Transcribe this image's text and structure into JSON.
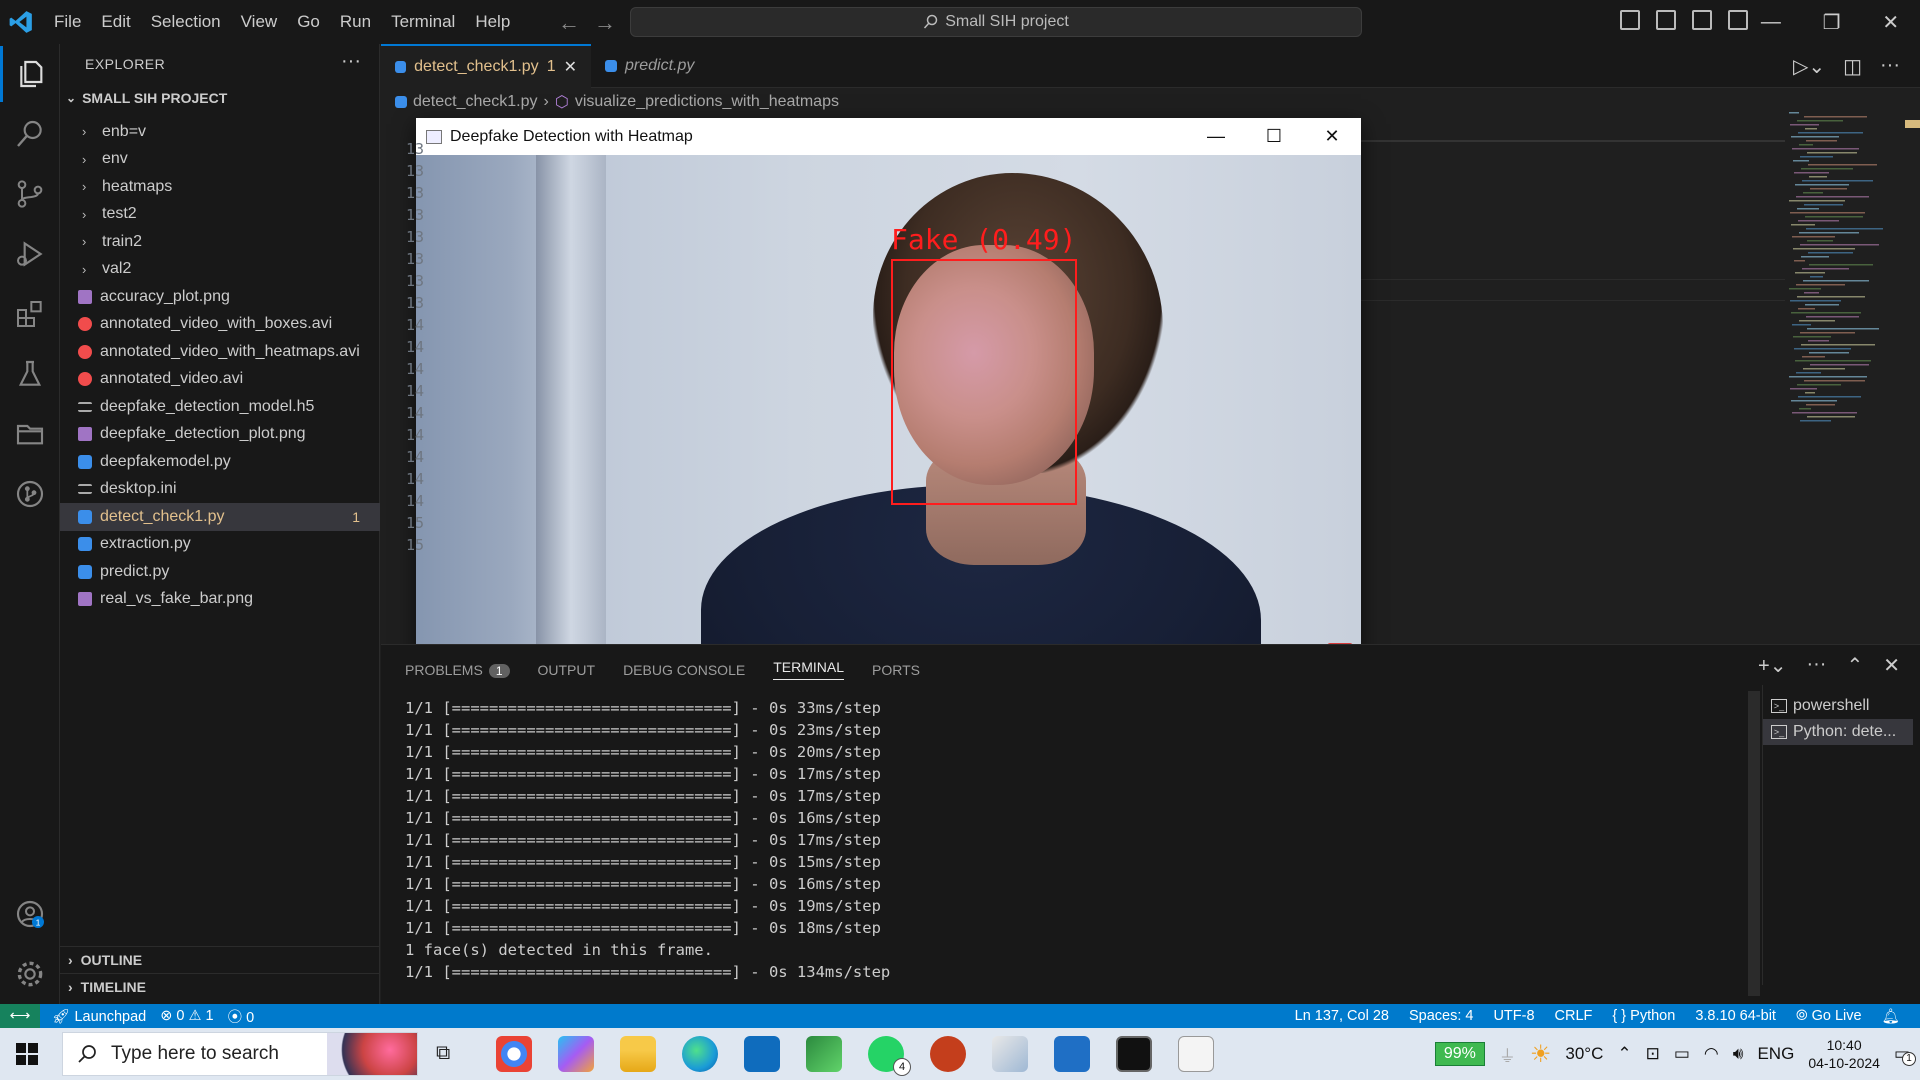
{
  "titlebar": {
    "menu": [
      "File",
      "Edit",
      "Selection",
      "View",
      "Go",
      "Run",
      "Terminal",
      "Help"
    ],
    "command_center": "Small SIH project"
  },
  "sidebar": {
    "header": "EXPLORER",
    "project": "SMALL SIH PROJECT",
    "folders": [
      "enb=v",
      "env",
      "heatmaps",
      "test2",
      "train2",
      "val2"
    ],
    "files": [
      {
        "name": "accuracy_plot.png",
        "type": "png"
      },
      {
        "name": "annotated_video_with_boxes.avi",
        "type": "avi"
      },
      {
        "name": "annotated_video_with_heatmaps.avi",
        "type": "avi"
      },
      {
        "name": "annotated_video.avi",
        "type": "avi"
      },
      {
        "name": "deepfake_detection_model.h5",
        "type": "txt"
      },
      {
        "name": "deepfake_detection_plot.png",
        "type": "png"
      },
      {
        "name": "deepfakemodel.py",
        "type": "py"
      },
      {
        "name": "desktop.ini",
        "type": "txt"
      },
      {
        "name": "detect_check1.py",
        "type": "py",
        "badge": "1",
        "active": true
      },
      {
        "name": "extraction.py",
        "type": "py"
      },
      {
        "name": "predict.py",
        "type": "py"
      },
      {
        "name": "real_vs_fake_bar.png",
        "type": "png"
      }
    ],
    "outline": "OUTLINE",
    "timeline": "TIMELINE"
  },
  "tabs": {
    "active": "detect_check1.py",
    "active_badge": "1",
    "second": "predict.py"
  },
  "breadcrumb": {
    "file": "detect_check1.py",
    "symbol": "visualize_predictions_with_heatmaps"
  },
  "editor": {
    "line_numbers": [
      "13",
      "13",
      "13",
      "13",
      "13",
      "13",
      "13",
      "13",
      "14",
      "14",
      "14",
      "14",
      "14",
      "14",
      "14",
      "14",
      "14",
      "15",
      "15"
    ]
  },
  "popup": {
    "title": "Deepfake Detection with Heatmap",
    "label": "Fake (0.49)"
  },
  "panel": {
    "tabs": [
      "PROBLEMS",
      "OUTPUT",
      "DEBUG CONSOLE",
      "TERMINAL",
      "PORTS"
    ],
    "problems_count": "1",
    "terminal_lines": [
      "1/1 [==============================] - 0s 33ms/step",
      "1/1 [==============================] - 0s 23ms/step",
      "1/1 [==============================] - 0s 20ms/step",
      "1/1 [==============================] - 0s 17ms/step",
      "1/1 [==============================] - 0s 17ms/step",
      "1/1 [==============================] - 0s 16ms/step",
      "1/1 [==============================] - 0s 17ms/step",
      "1/1 [==============================] - 0s 15ms/step",
      "1/1 [==============================] - 0s 16ms/step",
      "1/1 [==============================] - 0s 19ms/step",
      "1/1 [==============================] - 0s 18ms/step",
      "1 face(s) detected in this frame.",
      "1/1 [==============================] - 0s 134ms/step"
    ],
    "terminals": [
      "powershell",
      "Python: dete..."
    ]
  },
  "statusbar": {
    "launchpad": "Launchpad",
    "errors": "0",
    "warnings": "1",
    "ports": "0",
    "position": "Ln 137, Col 28",
    "spaces": "Spaces: 4",
    "encoding": "UTF-8",
    "eol": "CRLF",
    "language": "Python",
    "interpreter": "3.8.10 64-bit",
    "golive": "Go Live"
  },
  "taskbar": {
    "search_placeholder": "Type here to search",
    "battery": "99%",
    "weather": "30°C",
    "lang": "ENG",
    "time": "10:40",
    "date": "04-10-2024",
    "whatsapp_badge": "4",
    "notif_badge": "1"
  },
  "colors": {
    "accent": "#007acc",
    "active_file": "#e2c08d",
    "box": "#ff1d1d"
  }
}
